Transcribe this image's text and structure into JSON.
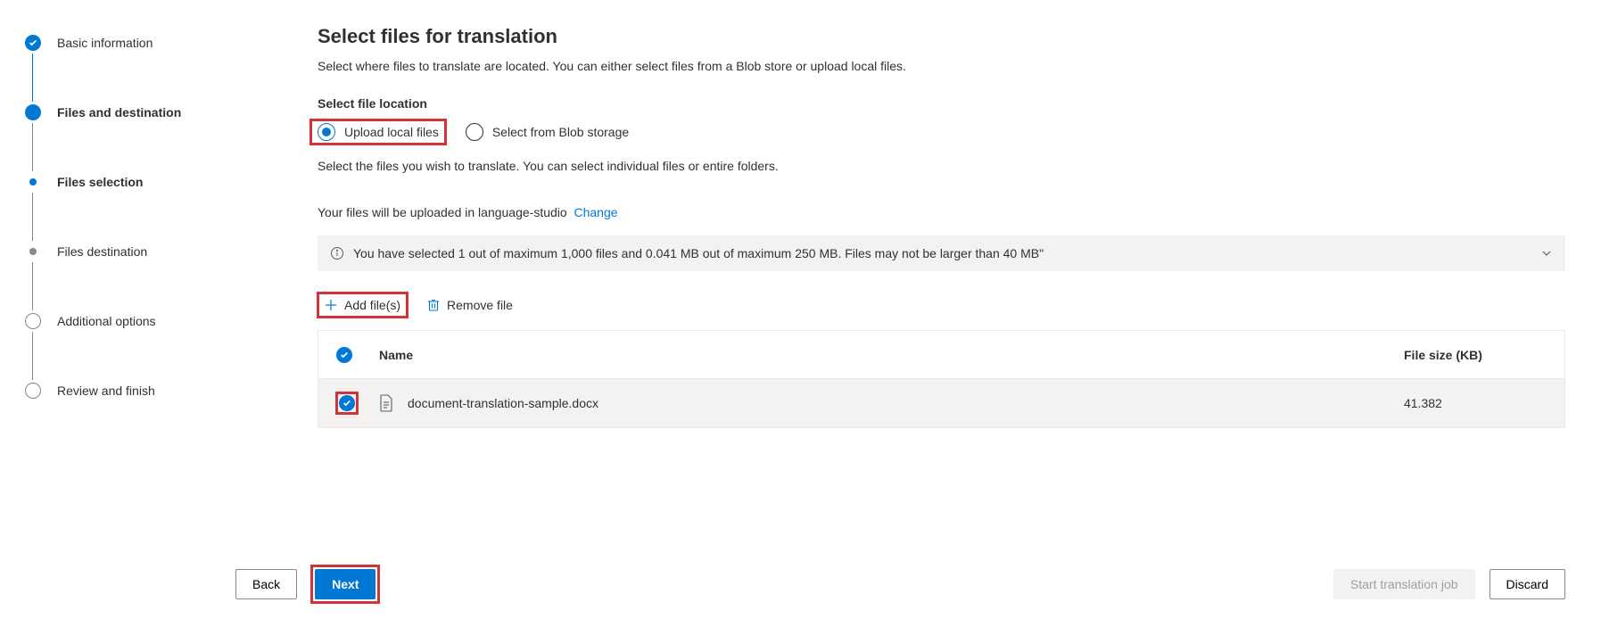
{
  "steps": [
    {
      "label": "Basic information",
      "state": "done"
    },
    {
      "label": "Files and destination",
      "state": "current"
    },
    {
      "label": "Files selection",
      "state": "sub-current"
    },
    {
      "label": "Files destination",
      "state": "sub-future"
    },
    {
      "label": "Additional options",
      "state": "future"
    },
    {
      "label": "Review and finish",
      "state": "future"
    }
  ],
  "main": {
    "title": "Select files for translation",
    "description": "Select where files to translate are located. You can either select files from a Blob store or upload local files.",
    "location_label": "Select file location",
    "radio_upload": "Upload local files",
    "radio_blob": "Select from Blob storage",
    "hint": "Select the files you wish to translate. You can select individual files or entire folders.",
    "upload_target_prefix": "Your files will be uploaded in language-studio",
    "change_link": "Change",
    "info_msg": "You have selected 1 out of maximum 1,000 files and 0.041 MB out of maximum 250 MB. Files may not be larger than 40 MB\"",
    "cmd_add": "Add file(s)",
    "cmd_remove": "Remove file",
    "col_name": "Name",
    "col_size": "File size (KB)",
    "row_file": "document-translation-sample.docx",
    "row_size": "41.382"
  },
  "footer": {
    "back": "Back",
    "next": "Next",
    "start": "Start translation job",
    "discard": "Discard"
  }
}
